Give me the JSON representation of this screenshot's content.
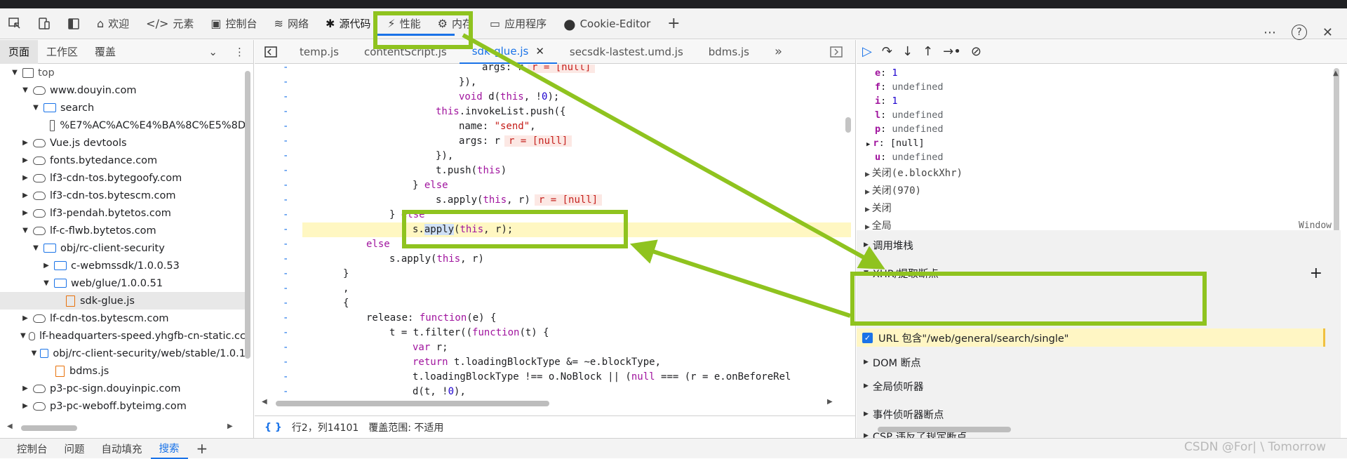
{
  "toolbar": {
    "tabs": [
      {
        "label": "欢迎",
        "icon": "home-icon"
      },
      {
        "label": "元素",
        "icon": "code-brackets-icon"
      },
      {
        "label": "控制台",
        "icon": "console-icon"
      },
      {
        "label": "网络",
        "icon": "wifi-icon"
      },
      {
        "label": "源代码",
        "icon": "bug-icon"
      },
      {
        "label": "性能",
        "icon": "performance-icon"
      },
      {
        "label": "内存",
        "icon": "memory-icon"
      },
      {
        "label": "应用程序",
        "icon": "application-icon"
      },
      {
        "label": "Cookie-Editor",
        "icon": "cookie-icon"
      }
    ],
    "active_tab": "源代码"
  },
  "sidebar": {
    "subtabs": [
      "页面",
      "工作区",
      "覆盖"
    ],
    "tree": [
      {
        "label": "top",
        "level": 0,
        "type": "frame",
        "open": true
      },
      {
        "label": "www.douyin.com",
        "level": 1,
        "type": "cloud",
        "open": true
      },
      {
        "label": "search",
        "level": 2,
        "type": "folder",
        "open": true
      },
      {
        "label": "%E7%AC%AC%E4%BA%8C%E5%8D",
        "level": 3,
        "type": "file"
      },
      {
        "label": "Vue.js devtools",
        "level": 1,
        "type": "cloud",
        "open": false
      },
      {
        "label": "fonts.bytedance.com",
        "level": 1,
        "type": "cloud",
        "open": false
      },
      {
        "label": "lf3-cdn-tos.bytegoofy.com",
        "level": 1,
        "type": "cloud",
        "open": false
      },
      {
        "label": "lf3-cdn-tos.bytescm.com",
        "level": 1,
        "type": "cloud",
        "open": false
      },
      {
        "label": "lf3-pendah.bytetos.com",
        "level": 1,
        "type": "cloud",
        "open": false
      },
      {
        "label": "lf-c-flwb.bytetos.com",
        "level": 1,
        "type": "cloud",
        "open": true
      },
      {
        "label": "obj/rc-client-security",
        "level": 2,
        "type": "folder",
        "open": true
      },
      {
        "label": "c-webmssdk/1.0.0.53",
        "level": 3,
        "type": "folder",
        "open": false
      },
      {
        "label": "web/glue/1.0.0.51",
        "level": 3,
        "type": "folder",
        "open": true
      },
      {
        "label": "sdk-glue.js",
        "level": 4,
        "type": "file-orange",
        "selected": true
      },
      {
        "label": "lf-cdn-tos.bytescm.com",
        "level": 1,
        "type": "cloud",
        "open": false
      },
      {
        "label": "lf-headquarters-speed.yhgfb-cn-static.cc",
        "level": 1,
        "type": "cloud",
        "open": true
      },
      {
        "label": "obj/rc-client-security/web/stable/1.0.1",
        "level": 2,
        "type": "folder",
        "open": true
      },
      {
        "label": "bdms.js",
        "level": 3,
        "type": "file-orange"
      },
      {
        "label": "p3-pc-sign.douyinpic.com",
        "level": 1,
        "type": "cloud",
        "open": false
      },
      {
        "label": "p3-pc-weboff.byteimg.com",
        "level": 1,
        "type": "cloud",
        "open": false
      }
    ]
  },
  "editor": {
    "tabs": [
      "temp.js",
      "contentScript.js",
      "sdk-glue.js",
      "secsdk-lastest.umd.js",
      "bdms.js"
    ],
    "active_tab": "sdk-glue.js",
    "code": [
      {
        "indent": 12,
        "parts": [
          [
            "plain",
            "args: r"
          ]
        ],
        "val": "r = [null]"
      },
      {
        "indent": 11,
        "parts": [
          [
            "plain",
            "}),"
          ]
        ]
      },
      {
        "indent": 11,
        "parts": [
          [
            "kw",
            "void"
          ],
          [
            "plain",
            " d("
          ],
          [
            "kw",
            "this"
          ],
          [
            "plain",
            ", !"
          ],
          [
            "num",
            "0"
          ],
          [
            "plain",
            ");"
          ]
        ]
      },
      {
        "indent": 10,
        "parts": [
          [
            "kw",
            "this"
          ],
          [
            "plain",
            ".invokeList.push({"
          ]
        ]
      },
      {
        "indent": 11,
        "parts": [
          [
            "plain",
            "name: "
          ],
          [
            "str",
            "\"send\""
          ],
          [
            "plain",
            ","
          ]
        ]
      },
      {
        "indent": 11,
        "parts": [
          [
            "plain",
            "args: r"
          ]
        ],
        "val": "r = [null]"
      },
      {
        "indent": 10,
        "parts": [
          [
            "plain",
            "}),"
          ]
        ]
      },
      {
        "indent": 10,
        "parts": [
          [
            "plain",
            "t.push("
          ],
          [
            "kw",
            "this"
          ],
          [
            "plain",
            ")"
          ]
        ]
      },
      {
        "indent": 9,
        "parts": [
          [
            "plain",
            "} "
          ],
          [
            "kw",
            "else"
          ]
        ]
      },
      {
        "indent": 10,
        "parts": [
          [
            "plain",
            "s.apply("
          ],
          [
            "kw",
            "this"
          ],
          [
            "plain",
            ", r)"
          ]
        ],
        "val": "r = [null]"
      },
      {
        "indent": 8,
        "parts": [
          [
            "plain",
            "} "
          ],
          [
            "kw",
            "else"
          ]
        ]
      },
      {
        "indent": 9,
        "parts": [
          [
            "plain",
            "s."
          ],
          [
            "sel",
            "apply"
          ],
          [
            "plain",
            "("
          ],
          [
            "kw",
            "this"
          ],
          [
            "plain",
            ", r);"
          ]
        ],
        "highlight": true
      },
      {
        "indent": 7,
        "parts": [
          [
            "kw",
            "else"
          ]
        ]
      },
      {
        "indent": 8,
        "parts": [
          [
            "plain",
            "s.apply("
          ],
          [
            "kw",
            "this"
          ],
          [
            "plain",
            ", r)"
          ]
        ]
      },
      {
        "indent": 6,
        "parts": [
          [
            "plain",
            "}"
          ]
        ]
      },
      {
        "indent": 6,
        "parts": [
          [
            "plain",
            ","
          ]
        ]
      },
      {
        "indent": 6,
        "parts": [
          [
            "plain",
            "{"
          ]
        ]
      },
      {
        "indent": 7,
        "parts": [
          [
            "plain",
            "release: "
          ],
          [
            "kw",
            "function"
          ],
          [
            "plain",
            "(e) {"
          ]
        ]
      },
      {
        "indent": 8,
        "parts": [
          [
            "plain",
            "t = t.filter(("
          ],
          [
            "kw",
            "function"
          ],
          [
            "plain",
            "(t) {"
          ]
        ]
      },
      {
        "indent": 9,
        "parts": [
          [
            "kw",
            "var"
          ],
          [
            "plain",
            " r;"
          ]
        ]
      },
      {
        "indent": 9,
        "parts": [
          [
            "kw",
            "return"
          ],
          [
            "plain",
            " t.loadingBlockType &= ~e.blockType,"
          ]
        ]
      },
      {
        "indent": 9,
        "parts": [
          [
            "plain",
            "t.loadingBlockType !== o.NoBlock || ("
          ],
          [
            "kw",
            "null"
          ],
          [
            "plain",
            " === (r = e.onBeforeRel"
          ]
        ]
      },
      {
        "indent": 9,
        "parts": [
          [
            "plain",
            "d(t, !"
          ],
          [
            "num",
            "0"
          ],
          [
            "plain",
            "),"
          ]
        ]
      }
    ],
    "status": {
      "position": "行2，列14101",
      "coverage": "覆盖范围: 不适用"
    }
  },
  "debugger": {
    "scope_vars": [
      {
        "name": "e",
        "value": "1",
        "kind": "num"
      },
      {
        "name": "f",
        "value": "undefined",
        "kind": "undef"
      },
      {
        "name": "i",
        "value": "1",
        "kind": "num"
      },
      {
        "name": "l",
        "value": "undefined",
        "kind": "undef"
      },
      {
        "name": "p",
        "value": "undefined",
        "kind": "undef"
      },
      {
        "name": "r",
        "value": "[null]",
        "kind": "arr",
        "expandable": true
      },
      {
        "name": "u",
        "value": "undefined",
        "kind": "undef"
      }
    ],
    "closures": [
      "关闭(e.blockXhr)",
      "关闭(970)",
      "关闭",
      "全局"
    ],
    "global_value": "Window",
    "sections": {
      "call_stack": "调用堆栈",
      "xhr": "XHR/提取断点",
      "dom": "DOM 断点",
      "global_listeners": "全局侦听器",
      "event_listeners": "事件侦听器断点",
      "csp": "CSP 违反了规定断点"
    },
    "xhr_breakpoint": "URL 包含\"/web/general/search/single\""
  },
  "drawer": {
    "tabs": [
      "控制台",
      "问题",
      "自动填充",
      "搜索"
    ],
    "active_tab": "搜索"
  },
  "watermark": "CSDN @For| \\ Tomorrow"
}
